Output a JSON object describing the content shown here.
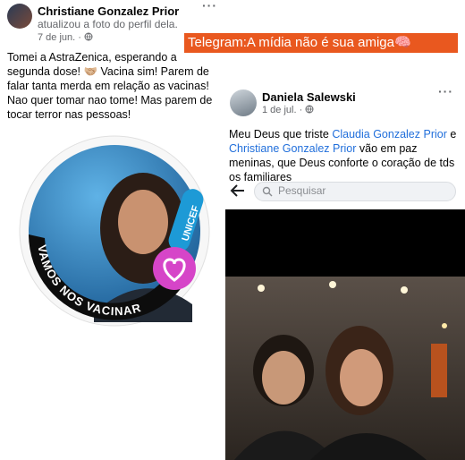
{
  "left_post": {
    "author": "Christiane Gonzalez Prior",
    "action": "atualizou a foto do perfil dela.",
    "date": "7 de jun. ·",
    "text": "Tomei a AstraZenica, esperando a segunda dose! 🤝🏼 Vacina sim! Parem de falar tanta merda em relação as vacinas! Nao quer tomar nao tome! Mas parem de tocar terror nas pessoas!",
    "frame_text": "VAMOS NOS VACINAR",
    "badge_text": "UNICEF"
  },
  "banner": {
    "text": "Telegram:A mídia não é sua amiga🧠"
  },
  "right_post": {
    "author": "Daniela Salewski",
    "date": "1 de jul. ·",
    "text_before": "Meu Deus que triste ",
    "link1": "Claudia Gonzalez Prior",
    "text_middle": " e ",
    "link2": "Christiane Gonzalez Prior",
    "text_after": " vão em paz meninas, que Deus conforte o coração de tds os familiares"
  },
  "search": {
    "placeholder": "Pesquisar"
  },
  "icons": {
    "more": "more-options-icon",
    "globe": "globe-icon",
    "back": "back-arrow-icon",
    "search": "search-icon"
  },
  "colors": {
    "banner_bg": "#e9581f",
    "link": "#216fdb",
    "frame_heart": "#d645c8"
  }
}
